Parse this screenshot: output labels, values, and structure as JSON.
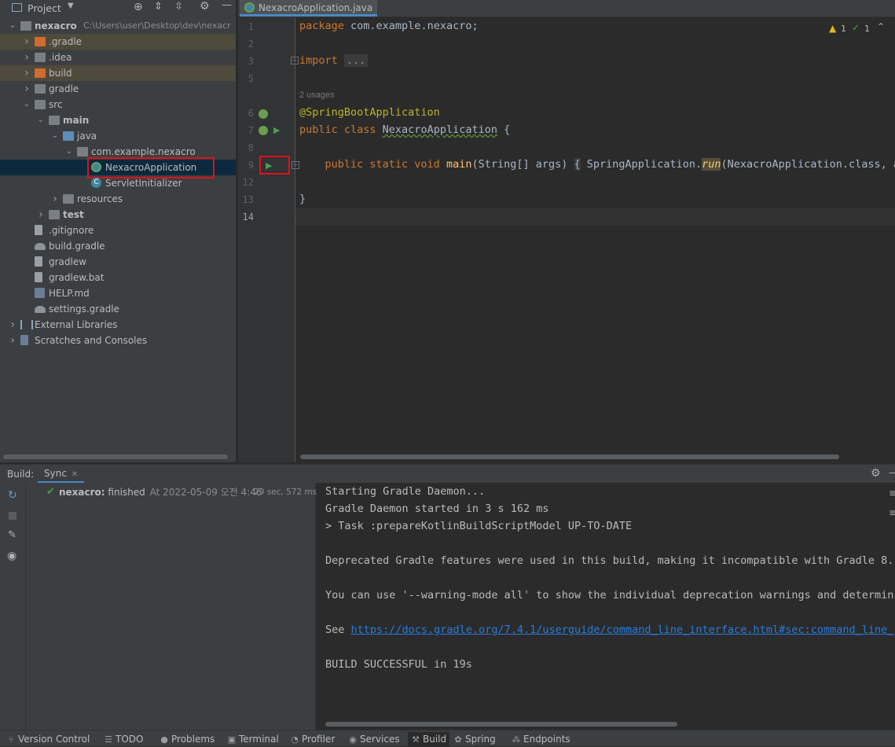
{
  "project_header": {
    "title": "Project",
    "icons": [
      "target-icon",
      "expand-all-icon",
      "collapse-all-icon",
      "gear-icon",
      "minimize-icon"
    ]
  },
  "project_tree": [
    {
      "label": "nexacro",
      "path": "C:\\Users\\user\\Desktop\\dev\\nexacr",
      "depth": 0,
      "chev": "open",
      "icon": "folder-gray",
      "bold": true
    },
    {
      "label": ".gradle",
      "depth": 1,
      "chev": "closed",
      "icon": "folder-orange",
      "highlight": true
    },
    {
      "label": ".idea",
      "depth": 1,
      "chev": "closed",
      "icon": "folder-gray"
    },
    {
      "label": "build",
      "depth": 1,
      "chev": "closed",
      "icon": "folder-orange",
      "highlight": true
    },
    {
      "label": "gradle",
      "depth": 1,
      "chev": "closed",
      "icon": "folder-gray"
    },
    {
      "label": "src",
      "depth": 1,
      "chev": "open",
      "icon": "folder-gray"
    },
    {
      "label": "main",
      "depth": 2,
      "chev": "open",
      "icon": "folder-gray",
      "bold": true
    },
    {
      "label": "java",
      "depth": 3,
      "chev": "open",
      "icon": "folder-blue"
    },
    {
      "label": "com.example.nexacro",
      "depth": 4,
      "chev": "open",
      "icon": "package"
    },
    {
      "label": "NexacroApplication",
      "depth": 5,
      "chev": "none",
      "icon": "spring-class",
      "selected": true
    },
    {
      "label": "ServletInitializer",
      "depth": 5,
      "chev": "none",
      "icon": "class"
    },
    {
      "label": "resources",
      "depth": 3,
      "chev": "closed",
      "icon": "folder-gray"
    },
    {
      "label": "test",
      "depth": 2,
      "chev": "closed",
      "icon": "folder-gray",
      "bold": true
    },
    {
      "label": ".gitignore",
      "depth": 1,
      "chev": "none",
      "icon": "file"
    },
    {
      "label": "build.gradle",
      "depth": 1,
      "chev": "none",
      "icon": "gradle"
    },
    {
      "label": "gradlew",
      "depth": 1,
      "chev": "none",
      "icon": "file"
    },
    {
      "label": "gradlew.bat",
      "depth": 1,
      "chev": "none",
      "icon": "file"
    },
    {
      "label": "HELP.md",
      "depth": 1,
      "chev": "none",
      "icon": "md"
    },
    {
      "label": "settings.gradle",
      "depth": 1,
      "chev": "none",
      "icon": "gradle"
    },
    {
      "label": "External Libraries",
      "depth": 0,
      "chev": "closed",
      "icon": "library"
    },
    {
      "label": "Scratches and Consoles",
      "depth": 0,
      "chev": "closed",
      "icon": "scratch"
    }
  ],
  "editor": {
    "tab_label": "NexacroApplication.java",
    "warnings": "1",
    "checks": "1",
    "usages": "2 usages",
    "lines": {
      "l1": "1",
      "l2": "2",
      "l3": "3",
      "l5": "5",
      "l6": "6",
      "l7": "7",
      "l8": "8",
      "l9": "9",
      "l12": "12",
      "l13": "13",
      "l14": "14"
    },
    "code": {
      "package_kw": "package",
      "package_name": " com.example.nexacro;",
      "import_kw": "import",
      "import_fold": "...",
      "annotation": "@SpringBootApplication",
      "public_class": "public class ",
      "class_name": "NexacroApplication",
      "brace_open": " {",
      "main_kw": "public static void ",
      "main_name": "main",
      "main_args": "(String[] args) ",
      "fold_brace": "{",
      "body_start": " SpringApplication.",
      "run": "run",
      "body_end": "(NexacroApplication.class, ar",
      "brace_close": "}"
    }
  },
  "build": {
    "label": "Build:",
    "tab": "Sync",
    "tree_item_name": "nexacro:",
    "tree_item_status": " finished",
    "tree_item_time": "At 2022-05-09 오전 4:46",
    "tree_item_duration": "29 sec, 572 ms",
    "console": [
      "Starting Gradle Daemon...",
      "Gradle Daemon started in 3 s 162 ms",
      "> Task :prepareKotlinBuildScriptModel UP-TO-DATE",
      "",
      "Deprecated Gradle features were used in this build, making it incompatible with Gradle 8.",
      "",
      "You can use '--warning-mode all' to show the individual deprecation warnings and determin",
      ""
    ],
    "see_prefix": "See ",
    "see_link": "https://docs.gradle.org/7.4.1/userguide/command_line_interface.html#sec:command_line_",
    "build_result": "BUILD SUCCESSFUL in 19s"
  },
  "statusbar": {
    "items": [
      {
        "label": "Version Control",
        "icon": "branch-icon"
      },
      {
        "label": "TODO",
        "icon": "list-icon"
      },
      {
        "label": "Problems",
        "icon": "problems-icon"
      },
      {
        "label": "Terminal",
        "icon": "terminal-icon"
      },
      {
        "label": "Profiler",
        "icon": "profiler-icon"
      },
      {
        "label": "Services",
        "icon": "services-icon"
      },
      {
        "label": "Build",
        "icon": "hammer-icon",
        "active": true
      },
      {
        "label": "Spring",
        "icon": "spring-icon"
      },
      {
        "label": "Endpoints",
        "icon": "endpoints-icon"
      }
    ]
  },
  "colors": {
    "accent_selection": "#0d293e",
    "highlight_excluded": "#4e4a3c",
    "annotation_box": "#e0101a",
    "run_green": "#499c54"
  }
}
